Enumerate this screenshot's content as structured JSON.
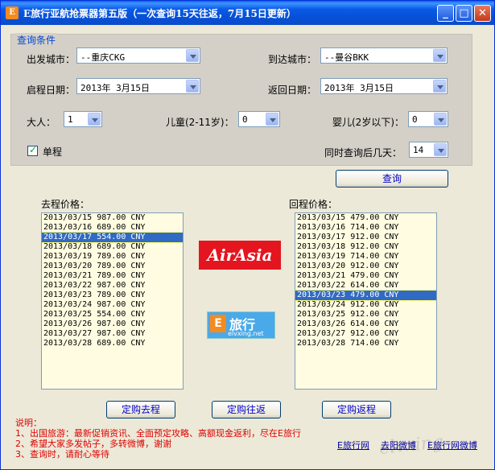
{
  "window": {
    "title": "E旅行亚航抢票器第五版（一次查询15天往返，7月15日更新）",
    "icon_label": "E",
    "controls": {
      "minimize": "_",
      "maximize": "□",
      "close": "✕"
    }
  },
  "query_group": {
    "title": "查询条件",
    "departure_city_label": "出发城市：",
    "departure_city_value": "--重庆CKG",
    "arrival_city_label": "到达城市：",
    "arrival_city_value": "--曼谷BKK",
    "depart_date_label": "启程日期：",
    "depart_date_value": "2013年 3月15日",
    "return_date_label": "返回日期：",
    "return_date_value": "2013年 3月15日",
    "adults_label": "大人：",
    "adults_value": "1",
    "children_label": "儿童(2-11岁)：",
    "children_value": "0",
    "infants_label": "婴儿(2岁以下)：",
    "infants_value": "0",
    "one_way_label": "单程",
    "one_way_checked": true,
    "days_label": "同时查询后几天：",
    "days_value": "14"
  },
  "search_button": "查询",
  "outbound": {
    "label": "去程价格：",
    "selected_index": 2,
    "items": [
      "2013/03/15 987.00 CNY",
      "2013/03/16 689.00 CNY",
      "2013/03/17 554.00 CNY",
      "2013/03/18 689.00 CNY",
      "2013/03/19 789.00 CNY",
      "2013/03/20 789.00 CNY",
      "2013/03/21 789.00 CNY",
      "2013/03/22 987.00 CNY",
      "2013/03/23 789.00 CNY",
      "2013/03/24 987.00 CNY",
      "2013/03/25 554.00 CNY",
      "2013/03/26 987.00 CNY",
      "2013/03/27 987.00 CNY",
      "2013/03/28 689.00 CNY"
    ]
  },
  "return": {
    "label": "回程价格：",
    "selected_index": 8,
    "items": [
      "2013/03/15 479.00 CNY",
      "2013/03/16 714.00 CNY",
      "2013/03/17 912.00 CNY",
      "2013/03/18 912.00 CNY",
      "2013/03/19 714.00 CNY",
      "2013/03/20 912.00 CNY",
      "2013/03/21 479.00 CNY",
      "2013/03/22 614.00 CNY",
      "2013/03/23 479.00 CNY",
      "2013/03/24 912.00 CNY",
      "2013/03/25 912.00 CNY",
      "2013/03/26 614.00 CNY",
      "2013/03/27 912.00 CNY",
      "2013/03/28 714.00 CNY"
    ]
  },
  "logos": {
    "airasia": "AirAsia",
    "elvxing_name": "旅行",
    "elvxing_url": "elvxing.net"
  },
  "buttons": {
    "book_outbound": "定购去程",
    "book_roundtrip": "定购往返",
    "book_return": "定购返程"
  },
  "notes": {
    "title": "说明：",
    "lines": [
      "1、出国旅游：最新促销资讯、全面预定攻略、高额现金返利，尽在E旅行",
      "2、希望大家多发帖子，多转微博，谢谢",
      "3、查询时，请耐心等待"
    ]
  },
  "footer_links": [
    "E旅行网",
    "去阳微博",
    "E旅行网微博"
  ],
  "watermark": "elvxing"
}
